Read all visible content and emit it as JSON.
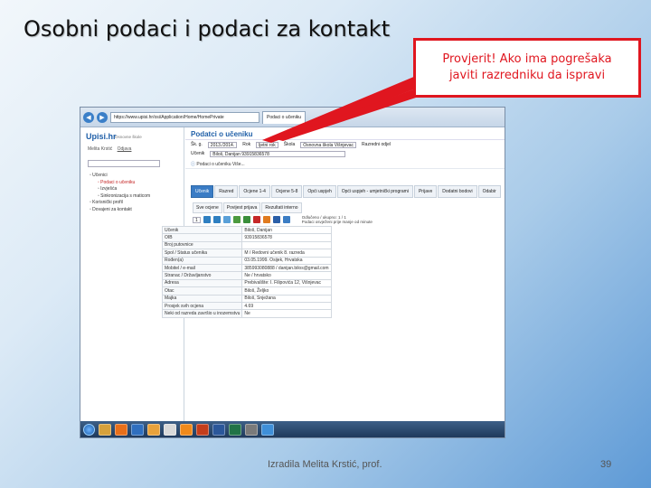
{
  "slide": {
    "title": "Osobni podaci i podaci za kontakt",
    "callout_line1": "Provjerit! Ako ima pogrešaka",
    "callout_line2": "javiti razredniku da ispravi",
    "author": "Izradila Melita Krstić, prof.",
    "page_number": "39",
    "accent_color": "#e0161f"
  },
  "browser": {
    "url": "https://www.upisi.hr/osi/Application/Home/HomePrivate",
    "tab_title": "Podaci o učeniku",
    "back_icon": "back-arrow-icon",
    "forward_icon": "forward-arrow-icon"
  },
  "app": {
    "logo": "Upisi.hr",
    "logo_sub": "Osnovne škole",
    "user_name": "Melita Krstić",
    "logout_label": "Odjava",
    "tree": [
      {
        "label": "Učenici",
        "selected": false,
        "indent": false
      },
      {
        "label": "Podaci o učeniku",
        "selected": true,
        "indent": true
      },
      {
        "label": "Izvješća",
        "selected": false,
        "indent": true
      },
      {
        "label": "Sinkronizacija s maticom",
        "selected": false,
        "indent": true
      },
      {
        "label": "Korisnički profil",
        "selected": false,
        "indent": false
      },
      {
        "label": "Dovajeni za kontakt",
        "selected": false,
        "indent": false
      }
    ]
  },
  "main": {
    "title": "Podatci o učeniku",
    "filter": {
      "year_label": "Šk. g.",
      "year_value": "2013./2014.",
      "round_label": "Rok",
      "round_value": "ljetni rok",
      "school_label": "Škola",
      "school_value": "Osnovna škola Višnjevac",
      "dept_label": "Razredni odjel",
      "student_label": "Učenik",
      "student_value": "Biloš, Danijan 93915836578"
    },
    "info_line": "Podaci o učeniku Više...",
    "tabs": [
      "Učenik",
      "Razred",
      "Ocjene 1-4",
      "Ocjene 5-8",
      "Opći uspjeh",
      "Opći uspjeh - umjetnički programi",
      "Prijave",
      "Dodatni bodovi",
      "Odabir"
    ],
    "subtabs": [
      "Sve ocjene",
      "Povijest prijava",
      "Rezultati interno"
    ],
    "page_select": "1",
    "pager_line1": "Odlučeno / ukupno: 1 / 1",
    "pager_line2": "Podaci osvježeni prije manje od minute",
    "rows": [
      {
        "key": "Učenik",
        "value": "Biloš, Danijan"
      },
      {
        "key": "OIB",
        "value": "93915836578"
      },
      {
        "key": "Broj putovnice",
        "value": ""
      },
      {
        "key": "Spol / Status učenika",
        "value": "M / Redovni učenik 8. razreda"
      },
      {
        "key": "Rođen(a)",
        "value": "03.05.1999. Osijek, Hrvatska"
      },
      {
        "key": "Mobitel / e-mail",
        "value": "385993080888 / danijan.bilos@gmail.com"
      },
      {
        "key": "Stranac / Državljanstvo",
        "value": "Ne / hrvatsko"
      },
      {
        "key": "Adresa",
        "value": "Prebivalište: I. Filipovića 12, Višnjevac"
      },
      {
        "key": "Otac",
        "value": "Biloš, Željko"
      },
      {
        "key": "Majka",
        "value": "Biloš, Snježana"
      },
      {
        "key": "Prosjek svih ocjena",
        "value": "4.69"
      },
      {
        "key": "Neki od razreda završio u inozemstvu",
        "value": "Ne"
      }
    ]
  },
  "taskbar": {
    "start_icon": "windows-start-icon"
  }
}
